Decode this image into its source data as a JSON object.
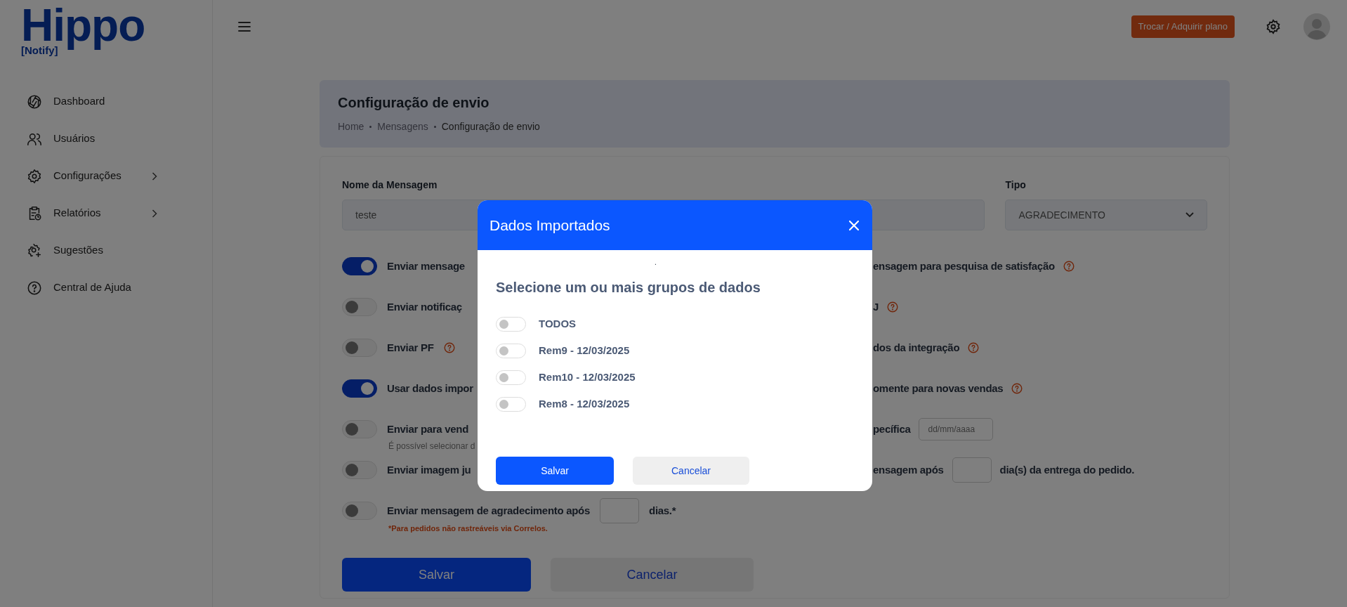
{
  "logo": {
    "name": "Hippo",
    "tagline": "[Notify]"
  },
  "header": {
    "plan_button": "Trocar / Adquirir plano"
  },
  "sidebar": {
    "items": [
      {
        "label": "Dashboard",
        "has_submenu": false
      },
      {
        "label": "Usuários",
        "has_submenu": false
      },
      {
        "label": "Configurações",
        "has_submenu": true
      },
      {
        "label": "Relatórios",
        "has_submenu": true
      },
      {
        "label": "Sugestões",
        "has_submenu": false
      },
      {
        "label": "Central de Ajuda",
        "has_submenu": false
      }
    ]
  },
  "page": {
    "title": "Configuração de envio",
    "breadcrumb": [
      "Home",
      "Mensagens",
      "Configuração de envio"
    ]
  },
  "form": {
    "name_label": "Nome da Mensagem",
    "name_value": "teste",
    "type_label": "Tipo",
    "type_value": "AGRADECIMENTO",
    "options": [
      {
        "on": true,
        "left": [
          {
            "kind": "text",
            "text": "Enviar mensage"
          }
        ],
        "right": [
          {
            "kind": "text",
            "text": "ensagem para pesquisa de satisfação"
          },
          {
            "kind": "help"
          }
        ]
      },
      {
        "on": false,
        "left": [
          {
            "kind": "text",
            "text": "Enviar notificaç"
          }
        ],
        "right": [
          {
            "kind": "text",
            "text": "J"
          },
          {
            "kind": "help"
          }
        ]
      },
      {
        "on": false,
        "left": [
          {
            "kind": "text",
            "text": "Enviar PF"
          },
          {
            "kind": "help"
          }
        ],
        "right": [
          {
            "kind": "text",
            "text": "dos da integração"
          },
          {
            "kind": "help"
          }
        ]
      },
      {
        "on": true,
        "left": [
          {
            "kind": "text",
            "text": "Usar dados impor"
          }
        ],
        "right": [
          {
            "kind": "text",
            "text": "omente para novas vendas"
          },
          {
            "kind": "help"
          }
        ]
      },
      {
        "on": false,
        "left": [
          {
            "kind": "text",
            "text": "Enviar para vend"
          }
        ],
        "sub": "É possível selecionar d",
        "right": [
          {
            "kind": "text",
            "text": "pecífica"
          },
          {
            "kind": "field",
            "placeholder": "dd/mm/aaaa"
          }
        ]
      },
      {
        "on": false,
        "left": [
          {
            "kind": "text",
            "text": "Enviar imagem ju"
          }
        ],
        "right": [
          {
            "kind": "text",
            "text": "ensagem após"
          },
          {
            "kind": "field"
          },
          {
            "kind": "text",
            "text": "dia(s) da entrega do pedido."
          }
        ]
      },
      {
        "on": false,
        "left": [
          {
            "kind": "text",
            "text": "Enviar mensagem de agradecimento após"
          },
          {
            "kind": "field"
          },
          {
            "kind": "text",
            "text": "dias.*"
          }
        ],
        "note": "*Para pedidos não rastreáveis via Correlos."
      }
    ],
    "buttons": [
      "Salvar",
      "Cancelar"
    ]
  },
  "modal": {
    "title": "Dados Importados",
    "mark": ".",
    "heading": "Selecione um ou mais grupos de dados",
    "groups": [
      {
        "label": "TODOS",
        "on": false
      },
      {
        "label": "Rem9 - 12/03/2025",
        "on": false
      },
      {
        "label": "Rem10 - 12/03/2025",
        "on": false
      },
      {
        "label": "Rem8 - 12/03/2025",
        "on": false
      }
    ],
    "buttons": [
      "Salvar",
      "Cancelar"
    ]
  }
}
